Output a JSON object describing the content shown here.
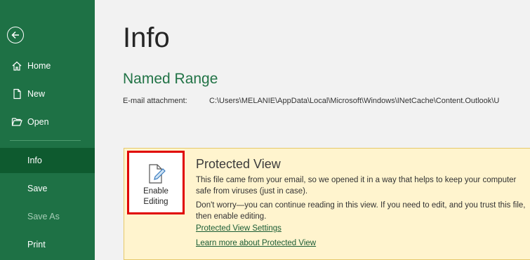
{
  "sidebar": {
    "back_icon": "back-arrow-icon",
    "items": [
      {
        "label": "Home",
        "icon": "home-icon"
      },
      {
        "label": "New",
        "icon": "new-document-icon"
      },
      {
        "label": "Open",
        "icon": "folder-open-icon"
      },
      {
        "label": "Info",
        "selected": true
      },
      {
        "label": "Save"
      },
      {
        "label": "Save As",
        "disabled": true
      },
      {
        "label": "Print"
      }
    ]
  },
  "main": {
    "title": "Info",
    "workbook_name": "Named Range",
    "attachment_label": "E-mail attachment:",
    "attachment_path": "C:\\Users\\MELANIE\\AppData\\Local\\Microsoft\\Windows\\INetCache\\Content.Outlook\\U"
  },
  "protected_view": {
    "button_label": "Enable Editing",
    "title": "Protected View",
    "text1": "This file came from your email, so we opened it in a way that helps to keep your computer safe from viruses (just in case).",
    "text2": "Don't worry—you can continue reading in this view. If you need to edit, and you trust this file, then enable editing.",
    "link1": "Protected View Settings",
    "link2": "Learn more about Protected View"
  },
  "colors": {
    "sidebar": "#1e7145",
    "sidebar_selected": "#0e5a2f",
    "accent": "#217346",
    "banner": "#fff4ce",
    "highlight": "#e00000"
  }
}
